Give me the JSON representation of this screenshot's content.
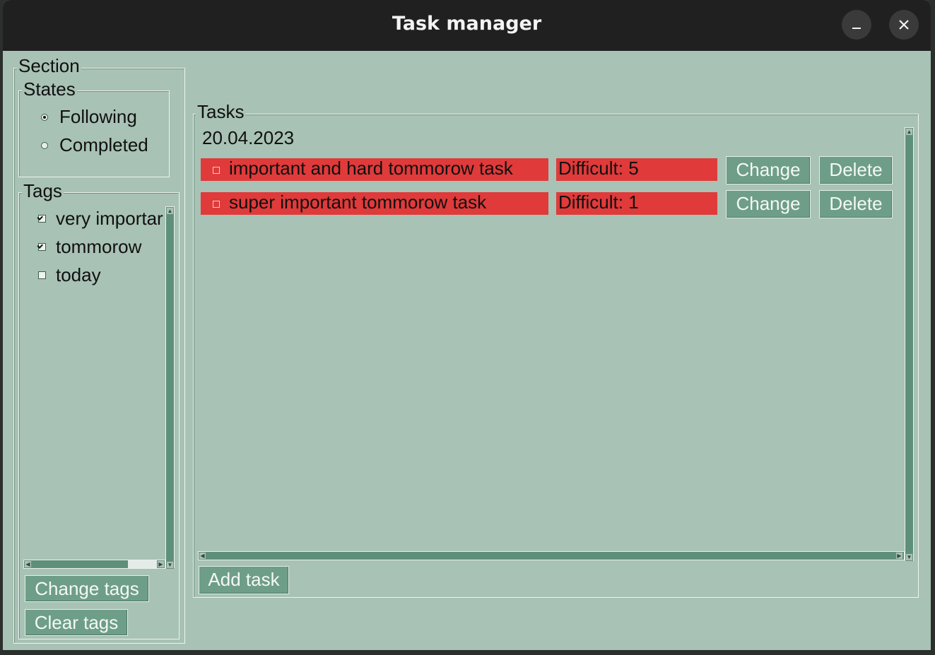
{
  "window": {
    "title": "Task manager",
    "minimize_icon": "minimize-icon",
    "close_icon": "close-icon"
  },
  "section": {
    "label": "Section",
    "states": {
      "label": "States",
      "options": [
        {
          "label": "Following",
          "selected": true
        },
        {
          "label": "Completed",
          "selected": false
        }
      ]
    },
    "tags": {
      "label": "Tags",
      "items": [
        {
          "label": "very importar",
          "checked": true
        },
        {
          "label": "tommorow",
          "checked": true
        },
        {
          "label": "today",
          "checked": false
        }
      ],
      "change_button": "Change tags",
      "clear_button": "Clear tags"
    }
  },
  "tasks": {
    "label": "Tasks",
    "date": "20.04.2023",
    "items": [
      {
        "name": "important and hard tommorow task",
        "difficulty": "Difficult: 5",
        "change": "Change",
        "delete": "Delete",
        "done": false
      },
      {
        "name": "super important tommorow task",
        "difficulty": "Difficult: 1",
        "change": "Change",
        "delete": "Delete",
        "done": false
      }
    ],
    "add_button": "Add task"
  },
  "colors": {
    "window_bg": "#a8c2b5",
    "titlebar": "#202020",
    "button": "#6e9e88",
    "task_highlight": "#e03a3a"
  }
}
